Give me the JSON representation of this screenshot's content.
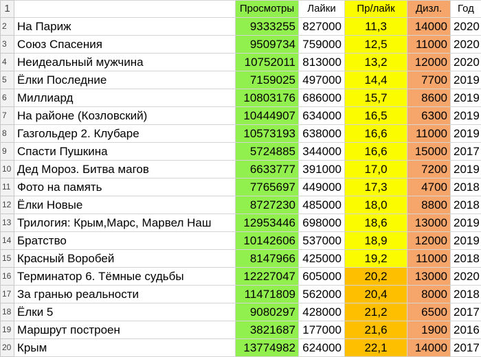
{
  "header": {
    "row_number": "1",
    "title_col": "",
    "views": "Просмотры",
    "likes": "Лайки",
    "views_per_like": "Пр/лайк",
    "dislikes": "Дизл.",
    "year": "Год"
  },
  "rows": [
    {
      "n": "2",
      "title": "На Париж",
      "views": "9333255",
      "likes": "827000",
      "ratio": "11,3",
      "dislikes": "14000",
      "year": "2020",
      "ratio_color": "yellow"
    },
    {
      "n": "3",
      "title": "Союз Спасения",
      "views": "9509734",
      "likes": "759000",
      "ratio": "12,5",
      "dislikes": "11000",
      "year": "2020",
      "ratio_color": "yellow"
    },
    {
      "n": "4",
      "title": "Неидеальный мужчина",
      "views": "10752011",
      "likes": "813000",
      "ratio": "13,2",
      "dislikes": "12000",
      "year": "2020",
      "ratio_color": "yellow"
    },
    {
      "n": "5",
      "title": "Ёлки Последние",
      "views": "7159025",
      "likes": "497000",
      "ratio": "14,4",
      "dislikes": "7700",
      "year": "2019",
      "ratio_color": "yellow"
    },
    {
      "n": "6",
      "title": "Миллиард",
      "views": "10803176",
      "likes": "686000",
      "ratio": "15,7",
      "dislikes": "8600",
      "year": "2019",
      "ratio_color": "yellow"
    },
    {
      "n": "7",
      "title": "На районе (Козловский)",
      "views": "10444907",
      "likes": "634000",
      "ratio": "16,5",
      "dislikes": "6300",
      "year": "2019",
      "ratio_color": "yellow"
    },
    {
      "n": "8",
      "title": "Газгольдер 2. Клубаре",
      "views": "10573193",
      "likes": "638000",
      "ratio": "16,6",
      "dislikes": "11000",
      "year": "2019",
      "ratio_color": "yellow"
    },
    {
      "n": "9",
      "title": "Спасти Пушкина",
      "views": "5724885",
      "likes": "344000",
      "ratio": "16,6",
      "dislikes": "15000",
      "year": "2017",
      "ratio_color": "yellow"
    },
    {
      "n": "10",
      "title": "Дед Мороз. Битва магов",
      "views": "6633777",
      "likes": "391000",
      "ratio": "17,0",
      "dislikes": "7200",
      "year": "2019",
      "ratio_color": "yellow"
    },
    {
      "n": "11",
      "title": "Фото на память",
      "views": "7765697",
      "likes": "449000",
      "ratio": "17,3",
      "dislikes": "4700",
      "year": "2018",
      "ratio_color": "yellow"
    },
    {
      "n": "12",
      "title": "Ёлки Новые",
      "views": "8727230",
      "likes": "485000",
      "ratio": "18,0",
      "dislikes": "8800",
      "year": "2018",
      "ratio_color": "yellow"
    },
    {
      "n": "13",
      "title": "Трилогия: Крым,Марс, Марвел Наш",
      "views": "12953446",
      "likes": "698000",
      "ratio": "18,6",
      "dislikes": "13000",
      "year": "2019",
      "ratio_color": "yellow"
    },
    {
      "n": "14",
      "title": "Братство",
      "views": "10142606",
      "likes": "537000",
      "ratio": "18,9",
      "dislikes": "12000",
      "year": "2019",
      "ratio_color": "yellow"
    },
    {
      "n": "15",
      "title": "Красный Воробей",
      "views": "8147966",
      "likes": "425000",
      "ratio": "19,2",
      "dislikes": "11000",
      "year": "2018",
      "ratio_color": "yellow"
    },
    {
      "n": "16",
      "title": "Терминатор 6. Тёмные судьбы",
      "views": "12227047",
      "likes": "605000",
      "ratio": "20,2",
      "dislikes": "13000",
      "year": "2020",
      "ratio_color": "orange"
    },
    {
      "n": "17",
      "title": "За гранью реальности",
      "views": "11471809",
      "likes": "562000",
      "ratio": "20,4",
      "dislikes": "8000",
      "year": "2018",
      "ratio_color": "orange"
    },
    {
      "n": "18",
      "title": "Ёлки 5",
      "views": "9080297",
      "likes": "428000",
      "ratio": "21,2",
      "dislikes": "6500",
      "year": "2017",
      "ratio_color": "orange"
    },
    {
      "n": "19",
      "title": "Маршрут построен",
      "views": "3821687",
      "likes": "177000",
      "ratio": "21,6",
      "dislikes": "1900",
      "year": "2016",
      "ratio_color": "orange"
    },
    {
      "n": "20",
      "title": "Крым",
      "views": "13774982",
      "likes": "624000",
      "ratio": "22,1",
      "dislikes": "14000",
      "year": "2017",
      "ratio_color": "orange"
    }
  ],
  "colors": {
    "views_fill": "#92f04e",
    "ratio_yellow": "#fcfc00",
    "ratio_orange": "#fdbf00",
    "dislikes_fill": "#f7a66b",
    "row_header_fill": "#f2f2f2",
    "gridline": "#d4d4d4"
  }
}
